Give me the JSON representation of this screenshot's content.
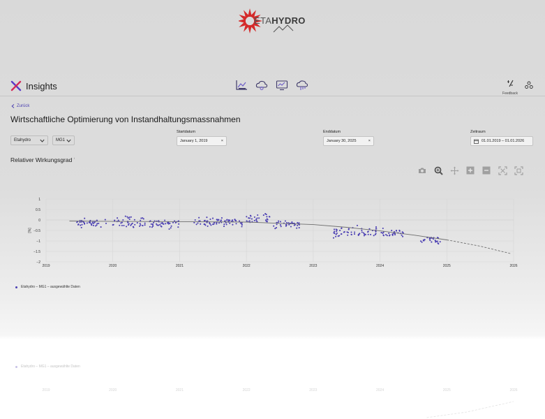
{
  "logo": {
    "brand_light": "ETA",
    "brand_bold": "HYDRO"
  },
  "app": {
    "title": "Insights"
  },
  "nav": {
    "icons": [
      "chart-line-icon",
      "cloud-gear-icon",
      "monitor-chart-icon",
      "cloud-chart-icon"
    ],
    "feedback_label": "Feedback"
  },
  "page": {
    "back_label": "Zurück",
    "title": "Wirtschaftliche Optimierung von Instandhaltungsmassnahmen"
  },
  "filters": {
    "company": "Etahydro",
    "unit": "MG1",
    "start_label": "Startdatum",
    "start_value": "January 1, 2019",
    "end_label": "Enddatum",
    "end_value": "January 30, 2025",
    "range_label": "Zeitraum",
    "range_value": "01.01.2019 – 01.01.2026",
    "clear_symbol": "×"
  },
  "chart_header": {
    "title": "Relativer Wirkungsgrad",
    "info": "i"
  },
  "toolbar": [
    "camera-icon",
    "zoom-icon",
    "pan-icon",
    "zoom-in-icon",
    "zoom-out-icon",
    "autoscale-icon",
    "reset-axes-icon"
  ],
  "chart_data": {
    "type": "scatter",
    "ylabel": "[%]",
    "ylim": [
      -2,
      1
    ],
    "xlim": [
      2019,
      2026
    ],
    "yticks": [
      "1",
      "0.5",
      "0",
      "−0.5",
      "−1",
      "−1.5",
      "−2"
    ],
    "xticks": [
      "2019",
      "2020",
      "2021",
      "2022",
      "2023",
      "2024",
      "2025",
      "2026"
    ],
    "series": [
      {
        "name": "Etahydro – MG1 – ausgewählte Daten",
        "color": "#4b3fb3",
        "clusters": [
          {
            "x0": 2019.45,
            "x1": 2019.92,
            "y": -0.12,
            "spread": 0.18
          },
          {
            "x0": 2020.0,
            "x1": 2020.5,
            "y": -0.1,
            "spread": 0.25
          },
          {
            "x0": 2020.55,
            "x1": 2021.0,
            "y": -0.15,
            "spread": 0.22
          },
          {
            "x0": 2021.2,
            "x1": 2021.95,
            "y": -0.08,
            "spread": 0.2
          },
          {
            "x0": 2022.0,
            "x1": 2022.35,
            "y": 0.05,
            "spread": 0.22
          },
          {
            "x0": 2022.4,
            "x1": 2022.8,
            "y": -0.2,
            "spread": 0.18
          },
          {
            "x0": 2023.3,
            "x1": 2023.95,
            "y": -0.55,
            "spread": 0.25
          },
          {
            "x0": 2024.0,
            "x1": 2024.35,
            "y": -0.6,
            "spread": 0.18
          },
          {
            "x0": 2024.6,
            "x1": 2024.9,
            "y": -0.95,
            "spread": 0.2
          }
        ]
      }
    ],
    "trend": [
      [
        2019.35,
        -0.05
      ],
      [
        2020.0,
        -0.07
      ],
      [
        2021.0,
        -0.08
      ],
      [
        2022.0,
        -0.1
      ],
      [
        2023.0,
        -0.22
      ],
      [
        2023.5,
        -0.35
      ],
      [
        2024.0,
        -0.52
      ],
      [
        2024.5,
        -0.72
      ],
      [
        2025.0,
        -0.95
      ]
    ],
    "forecast": [
      [
        2025.0,
        -0.95
      ],
      [
        2025.5,
        -1.25
      ],
      [
        2025.95,
        -1.6
      ]
    ],
    "grid": true,
    "legend": "bottom-left"
  }
}
